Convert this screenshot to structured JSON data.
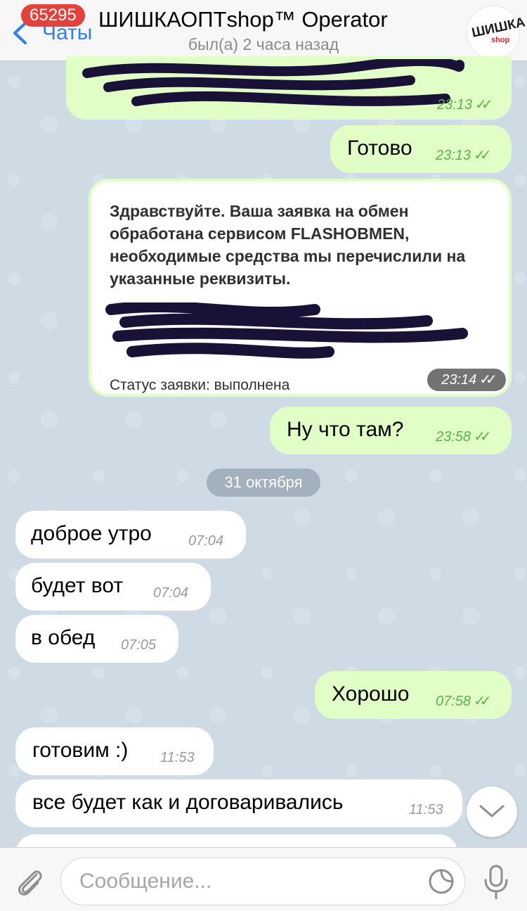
{
  "header": {
    "unread_count": "65295",
    "back_label": "Чаты",
    "title": "ШИШКАОПТshop™ Operator",
    "status": "был(а) 2 часа назад",
    "avatar_text": "ШИШКА",
    "avatar_sub": "shop"
  },
  "messages": {
    "m1_time": "23:13",
    "m2_text": "Готово",
    "m2_time": "23:13",
    "m3_text": "Здравствуйте. Ваша заявка на обмен обработана сервисом FLASHOBMEN, необходимые средства mы перечислили на указанные реквизиты.",
    "m3_status": "Статус заявки: выполнена",
    "m3_time": "23:14",
    "m4_text": "Ну что там?",
    "m4_time": "23:58",
    "date_divider": "31 октября",
    "m5_text": "доброе утро",
    "m5_time": "07:04",
    "m6_text": "будет вот",
    "m6_time": "07:04",
    "m7_text": "в обед",
    "m7_time": "07:05",
    "m8_text": "Хорошо",
    "m8_time": "07:58",
    "m9_text": "готовим :)",
    "m9_time": "11:53",
    "m10_text": "все будет как и договаривались",
    "m10_time": "11:53"
  },
  "composer": {
    "placeholder": "Сообщение..."
  },
  "colors": {
    "outgoing_bubble": "#e1fec6",
    "incoming_bubble": "#ffffff",
    "accent": "#2f7ff2",
    "badge": "#e3413c",
    "time_outgoing": "#5bb448"
  }
}
